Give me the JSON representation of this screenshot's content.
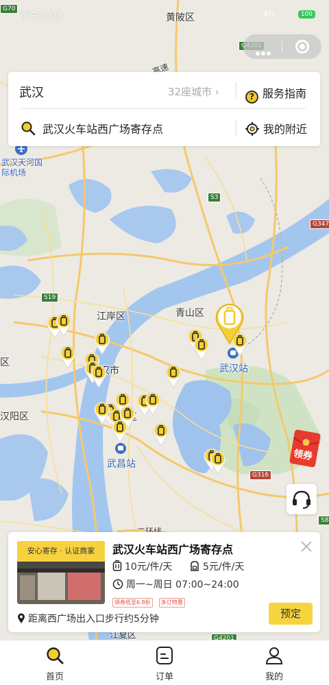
{
  "status_bar": {
    "time": "下午5:03",
    "battery": "100",
    "network": "4G"
  },
  "map": {
    "districts": [
      "黄陂区",
      "江岸区",
      "青山区",
      "武汉站",
      "武昌站",
      "汉阳区",
      "江夏区",
      "武汉天河国际机场"
    ],
    "route_shields": [
      "G70",
      "G4201",
      "S3",
      "G347",
      "S19",
      "G316",
      "G4201",
      "S8"
    ],
    "partial_labels": {
      "hankou_city": "汉口",
      "hanyang_left": "区",
      "river_road": "二环线",
      "jiangxia": "江夏区",
      "wuchang_frag": "区",
      "hankou_suffix": "汉市",
      "highway": "高速"
    },
    "accent_color": "#f2cf36"
  },
  "top_card": {
    "city": "武汉",
    "city_count": "32座城市",
    "guide_label": "服务指南",
    "search_value": "武汉火车站西广场寄存点",
    "nearby_label": "我的附近"
  },
  "coupon": {
    "label": "领券"
  },
  "store_card": {
    "photo_tag": "安心寄存 · 认证商家",
    "name": "武汉火车站西广场寄存点",
    "price_large": "10元/件/天",
    "price_small": "5元/件/天",
    "hours": "周一~周日 07:00~24:00",
    "badges": [
      "领券低至6.8折",
      "多订特惠"
    ],
    "distance": "距离西广场出入口步行约5分钟",
    "book_label": "预定"
  },
  "tabs": [
    {
      "label": "首页",
      "icon": "search-icon",
      "active": true
    },
    {
      "label": "订单",
      "icon": "order-icon",
      "active": false
    },
    {
      "label": "我的",
      "icon": "profile-icon",
      "active": false
    }
  ]
}
